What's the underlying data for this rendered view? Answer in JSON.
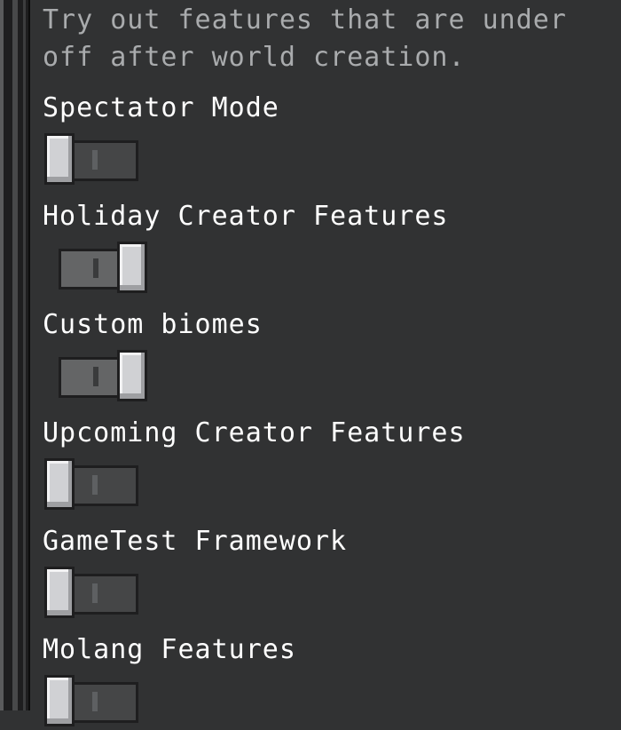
{
  "description": {
    "line1": "Try out features that are under",
    "line2": "off after world creation."
  },
  "settings": [
    {
      "label": "Spectator Mode",
      "enabled": false
    },
    {
      "label": "Holiday Creator Features",
      "enabled": true
    },
    {
      "label": "Custom biomes",
      "enabled": true
    },
    {
      "label": "Upcoming Creator Features",
      "enabled": false
    },
    {
      "label": "GameTest Framework",
      "enabled": false
    },
    {
      "label": "Molang Features",
      "enabled": false
    }
  ]
}
